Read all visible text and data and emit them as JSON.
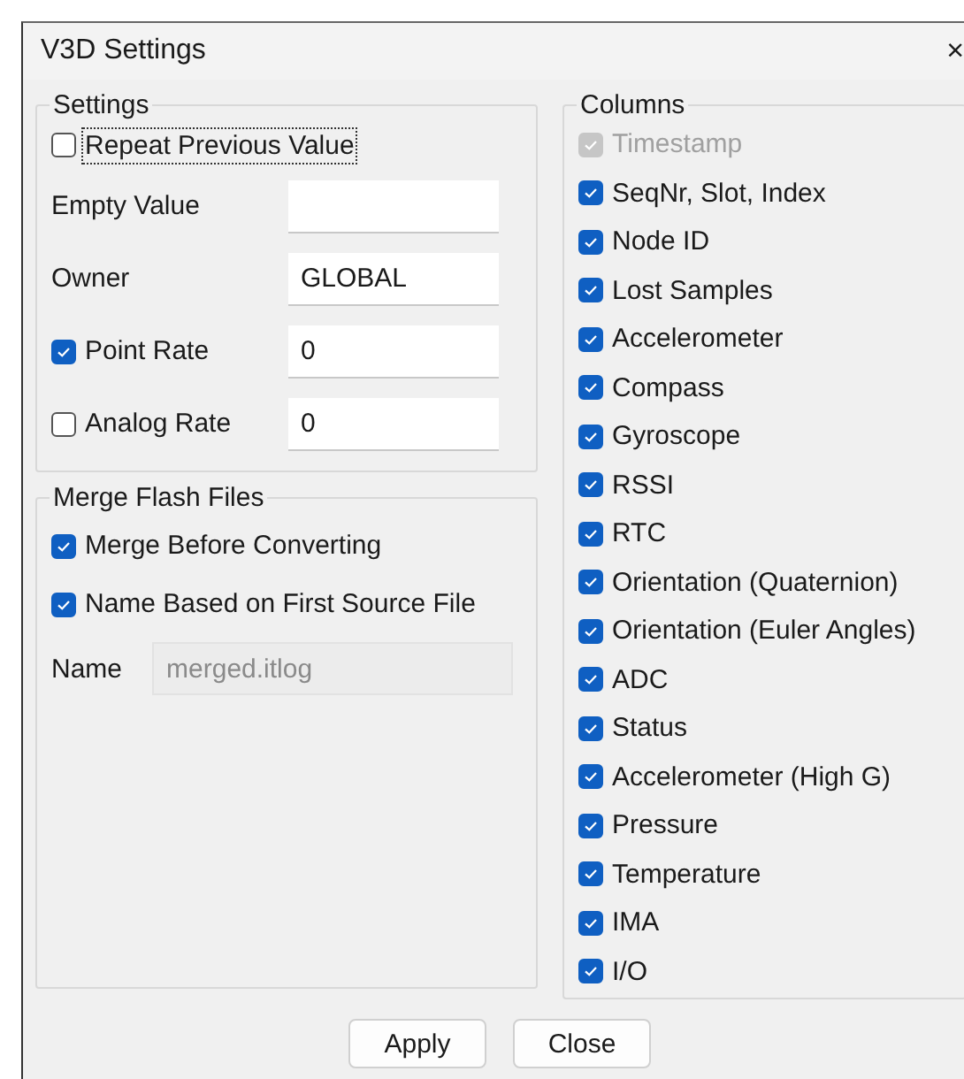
{
  "window": {
    "title": "V3D Settings",
    "close": "×"
  },
  "settings": {
    "title": "Settings",
    "rows": [
      {
        "kind": "checkbox",
        "label": "Repeat Previous Value",
        "checked": false,
        "focused": true
      },
      {
        "kind": "field",
        "label": "Empty Value",
        "value": ""
      },
      {
        "kind": "field",
        "label": "Owner",
        "value": "GLOBAL"
      },
      {
        "kind": "checkfield",
        "label": "Point Rate",
        "checked": true,
        "value": "0"
      },
      {
        "kind": "checkfield",
        "label": "Analog Rate",
        "checked": false,
        "value": "0"
      }
    ]
  },
  "merge": {
    "title": "Merge Flash Files",
    "options": [
      {
        "label": "Merge Before Converting",
        "checked": true
      },
      {
        "label": "Name Based on First Source File",
        "checked": true
      }
    ],
    "name_field": {
      "label": "Name",
      "value": "merged.itlog",
      "disabled": true
    }
  },
  "columns": {
    "title": "Columns",
    "items": [
      {
        "label": "Timestamp",
        "checked": true,
        "disabled": true
      },
      {
        "label": "SeqNr, Slot, Index",
        "checked": true,
        "disabled": false
      },
      {
        "label": "Node ID",
        "checked": true,
        "disabled": false
      },
      {
        "label": "Lost Samples",
        "checked": true,
        "disabled": false
      },
      {
        "label": "Accelerometer",
        "checked": true,
        "disabled": false
      },
      {
        "label": "Compass",
        "checked": true,
        "disabled": false
      },
      {
        "label": "Gyroscope",
        "checked": true,
        "disabled": false
      },
      {
        "label": "RSSI",
        "checked": true,
        "disabled": false
      },
      {
        "label": "RTC",
        "checked": true,
        "disabled": false
      },
      {
        "label": "Orientation (Quaternion)",
        "checked": true,
        "disabled": false
      },
      {
        "label": "Orientation (Euler Angles)",
        "checked": true,
        "disabled": false
      },
      {
        "label": "ADC",
        "checked": true,
        "disabled": false
      },
      {
        "label": "Status",
        "checked": true,
        "disabled": false
      },
      {
        "label": "Accelerometer (High G)",
        "checked": true,
        "disabled": false
      },
      {
        "label": "Pressure",
        "checked": true,
        "disabled": false
      },
      {
        "label": "Temperature",
        "checked": true,
        "disabled": false
      },
      {
        "label": "IMA",
        "checked": true,
        "disabled": false
      },
      {
        "label": "I/O",
        "checked": true,
        "disabled": false
      }
    ]
  },
  "buttons": [
    "Apply",
    "Close"
  ]
}
